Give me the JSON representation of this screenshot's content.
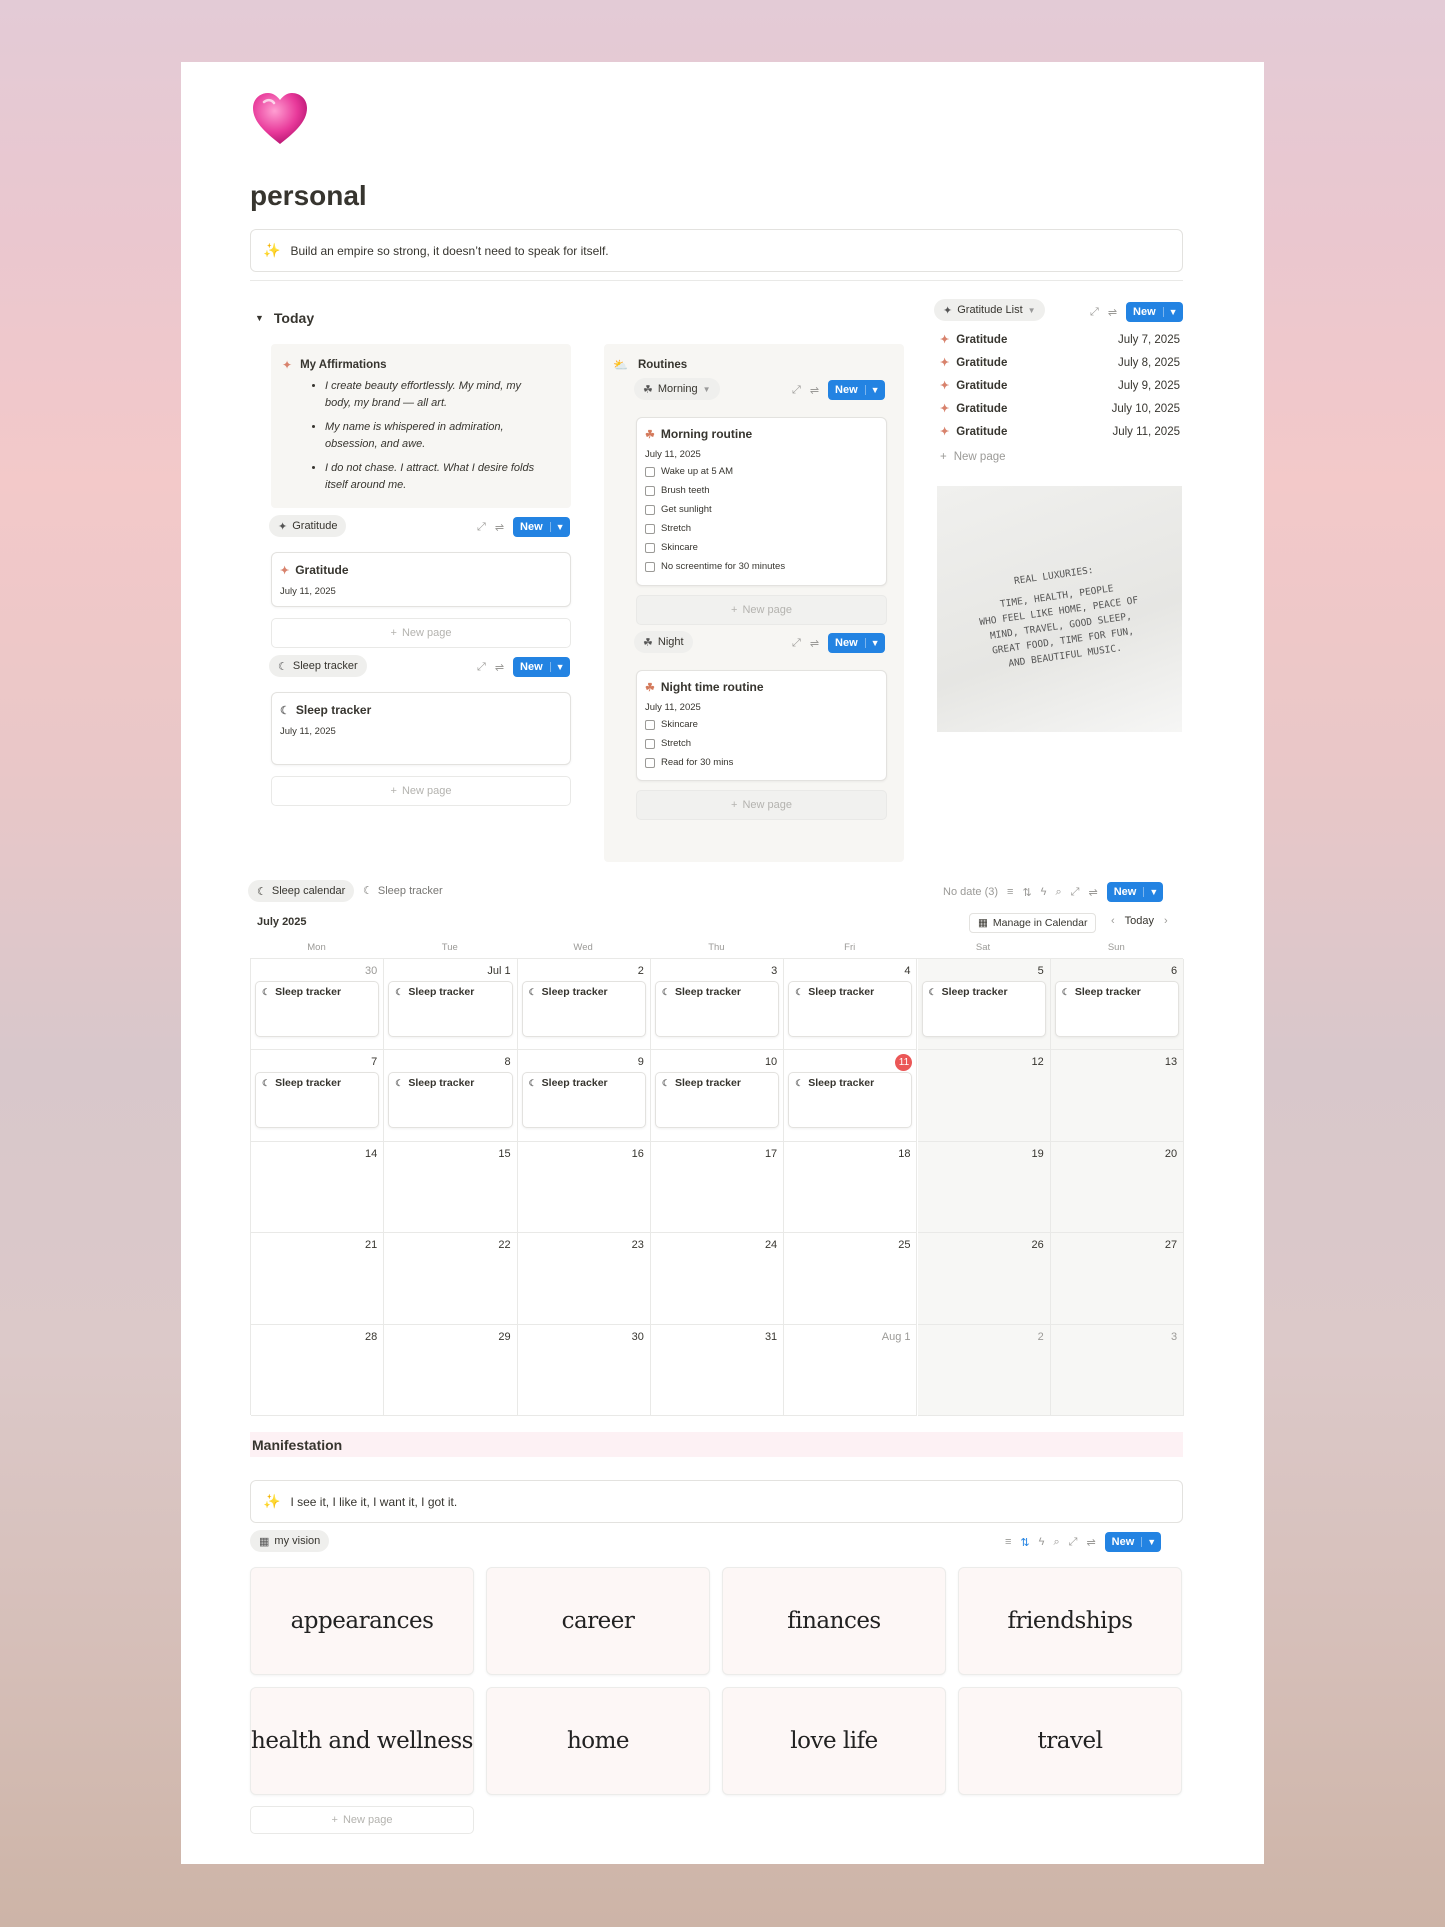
{
  "page": {
    "icon": "heart-emoji",
    "title": "personal",
    "quote": "Build an empire so strong, it doesn’t need to speak for itself."
  },
  "today": {
    "heading": "Today",
    "affirmations": {
      "title": "My Affirmations",
      "items": [
        "I create beauty effortlessly. My mind, my body, my brand — all art.",
        "My name is whispered in admiration, obsession, and awe.",
        "I do not chase. I attract. What I desire folds itself around me."
      ]
    },
    "gratitude_view": {
      "label": "Gratitude",
      "new_label": "New",
      "card_title": "Gratitude",
      "card_date": "July 11, 2025",
      "new_page": "New page"
    },
    "sleep_view": {
      "label": "Sleep tracker",
      "new_label": "New",
      "card_title": "Sleep tracker",
      "card_date": "July 11, 2025",
      "new_page": "New page"
    },
    "routines": {
      "title": "Routines",
      "morning": {
        "label": "Morning",
        "new_label": "New",
        "card_title": "Morning routine",
        "card_date": "July 11, 2025",
        "tasks": [
          "Wake up at 5 AM",
          "Brush teeth",
          "Get sunlight",
          "Stretch",
          "Skincare",
          "No screentime for 30 minutes"
        ],
        "new_page": "New page"
      },
      "night": {
        "label": "Night",
        "new_label": "New",
        "card_title": "Night time routine",
        "card_date": "July 11, 2025",
        "tasks": [
          "Skincare",
          "Stretch",
          "Read for 30 mins"
        ],
        "new_page": "New page"
      }
    }
  },
  "gratitude_list": {
    "label": "Gratitude List",
    "new_label": "New",
    "rows": [
      {
        "title": "Gratitude",
        "date": "July 7, 2025"
      },
      {
        "title": "Gratitude",
        "date": "July 8, 2025"
      },
      {
        "title": "Gratitude",
        "date": "July 9, 2025"
      },
      {
        "title": "Gratitude",
        "date": "July 10, 2025"
      },
      {
        "title": "Gratitude",
        "date": "July 11, 2025"
      }
    ],
    "new_page": "New page",
    "image_lines": [
      "REAL LUXURIES:",
      "TIME, HEALTH, PEOPLE",
      "WHO FEEL LIKE HOME, PEACE OF",
      "MIND, TRAVEL, GOOD SLEEP,",
      "GREAT FOOD, TIME FOR FUN,",
      "AND BEAUTIFUL MUSIC."
    ]
  },
  "calendar": {
    "tabs": [
      "Sleep calendar",
      "Sleep tracker"
    ],
    "no_date": "No date (3)",
    "new_label": "New",
    "month": "July 2025",
    "manage": "Manage in Calendar",
    "today_btn": "Today",
    "weekdays": [
      "Mon",
      "Tue",
      "Wed",
      "Thu",
      "Fri",
      "Sat",
      "Sun"
    ],
    "weeks": [
      [
        {
          "d": "30",
          "muted": true,
          "ev": "Sleep tracker"
        },
        {
          "d": "Jul 1",
          "ev": "Sleep tracker"
        },
        {
          "d": "2",
          "ev": "Sleep tracker"
        },
        {
          "d": "3",
          "ev": "Sleep tracker"
        },
        {
          "d": "4",
          "ev": "Sleep tracker"
        },
        {
          "d": "5",
          "ev": "Sleep tracker"
        },
        {
          "d": "6",
          "ev": "Sleep tracker"
        }
      ],
      [
        {
          "d": "7",
          "ev": "Sleep tracker"
        },
        {
          "d": "8",
          "ev": "Sleep tracker"
        },
        {
          "d": "9",
          "ev": "Sleep tracker"
        },
        {
          "d": "10",
          "ev": "Sleep tracker"
        },
        {
          "d": "11",
          "today": true,
          "ev": "Sleep tracker"
        },
        {
          "d": "12"
        },
        {
          "d": "13"
        }
      ],
      [
        {
          "d": "14"
        },
        {
          "d": "15"
        },
        {
          "d": "16"
        },
        {
          "d": "17"
        },
        {
          "d": "18"
        },
        {
          "d": "19"
        },
        {
          "d": "20"
        }
      ],
      [
        {
          "d": "21"
        },
        {
          "d": "22"
        },
        {
          "d": "23"
        },
        {
          "d": "24"
        },
        {
          "d": "25"
        },
        {
          "d": "26"
        },
        {
          "d": "27"
        }
      ],
      [
        {
          "d": "28"
        },
        {
          "d": "29"
        },
        {
          "d": "30"
        },
        {
          "d": "31"
        },
        {
          "d": "Aug 1",
          "muted": true
        },
        {
          "d": "2",
          "muted": true
        },
        {
          "d": "3",
          "muted": true
        }
      ]
    ]
  },
  "manifestation": {
    "heading": "Manifestation",
    "quote": "I see it, I like it, I want it, I got it.",
    "view_label": "my vision",
    "new_label": "New",
    "cards": [
      "appearances",
      "career",
      "finances",
      "friendships",
      "health and wellness",
      "home",
      "love life",
      "travel"
    ],
    "new_page": "New page"
  },
  "colors": {
    "accent": "#2383e2",
    "today": "#eb5757",
    "heading_band": "#fdf1f4"
  }
}
